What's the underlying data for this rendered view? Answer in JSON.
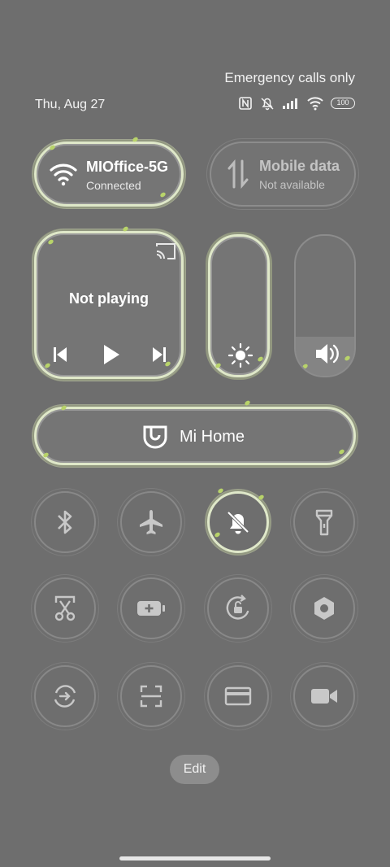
{
  "status": {
    "emergency": "Emergency calls only",
    "date": "Thu, Aug 27",
    "battery": "100"
  },
  "wifi": {
    "title": "MIOffice-5G",
    "subtitle": "Connected"
  },
  "mobile": {
    "title": "Mobile data",
    "subtitle": "Not available"
  },
  "media": {
    "status": "Not playing"
  },
  "mihome": {
    "label": "Mi Home"
  },
  "volume": {
    "level": 0.28
  },
  "toggles": [
    {
      "name": "bluetooth",
      "icon": "bluetooth-icon",
      "active": false
    },
    {
      "name": "airplane-mode",
      "icon": "airplane-icon",
      "active": false
    },
    {
      "name": "mute",
      "icon": "bell-off-icon",
      "active": true
    },
    {
      "name": "flashlight",
      "icon": "flashlight-icon",
      "active": false
    },
    {
      "name": "screenshot",
      "icon": "scissors-icon",
      "active": false
    },
    {
      "name": "battery-saver",
      "icon": "battery-plus-icon",
      "active": false
    },
    {
      "name": "rotation-lock",
      "icon": "rotation-lock-icon",
      "active": false
    },
    {
      "name": "settings-hex",
      "icon": "hex-nut-icon",
      "active": false
    },
    {
      "name": "data-saver",
      "icon": "sync-arrow-icon",
      "active": false
    },
    {
      "name": "scanner",
      "icon": "scan-frame-icon",
      "active": false
    },
    {
      "name": "card",
      "icon": "card-icon",
      "active": false
    },
    {
      "name": "screen-record",
      "icon": "video-camera-icon",
      "active": false
    }
  ],
  "edit": {
    "label": "Edit"
  },
  "colors": {
    "background": "#6e6e6e",
    "accent": "#dfe8c9",
    "leaf": "#b8d36a"
  }
}
